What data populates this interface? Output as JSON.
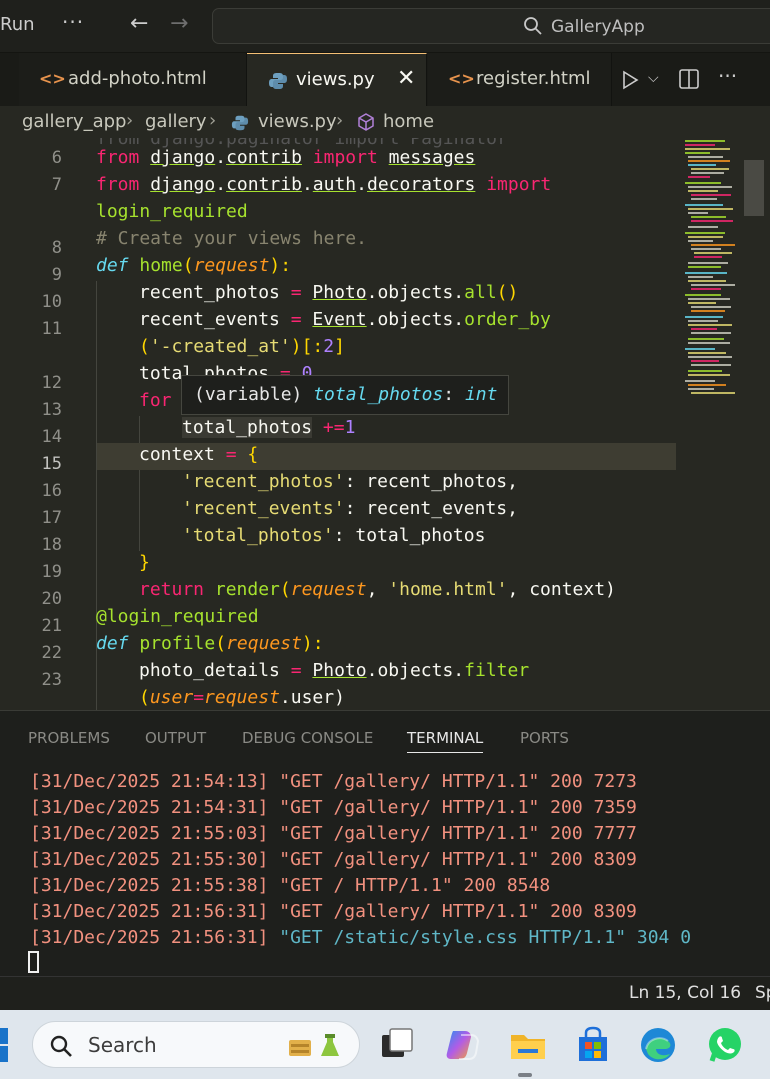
{
  "titlebar": {
    "run_label": "Run",
    "more_label": "···",
    "back_icon": "arrow-left-icon",
    "forward_icon": "arrow-right-icon",
    "search_text": "GalleryApp"
  },
  "tabs": [
    {
      "label": "add-photo.html",
      "icon": "html-icon"
    },
    {
      "label": "views.py",
      "icon": "python-icon",
      "close": "✕"
    },
    {
      "label": "register.html",
      "icon": "html-icon"
    }
  ],
  "breadcrumb": {
    "items": [
      "gallery_app",
      "gallery",
      "views.py",
      "home"
    ],
    "separator": "›"
  },
  "editor": {
    "line_numbers": [
      "6",
      "7",
      "",
      "8",
      "9",
      "10",
      "11",
      "",
      "12",
      "13",
      "14",
      "15",
      "16",
      "17",
      "18",
      "19",
      "20",
      "21",
      "22",
      "23",
      ""
    ],
    "current_line": "15",
    "hover": {
      "prefix": "(variable) ",
      "name": "total_photos",
      "colon": ": ",
      "type": "int"
    },
    "partial_top": "from django.paginator import Paginator",
    "code": {
      "l6": [
        "from",
        "django",
        ".",
        "contrib",
        "import",
        "messages"
      ],
      "l7": [
        "from",
        "django",
        ".",
        "contrib",
        ".",
        "auth",
        ".",
        "decorators",
        "import"
      ],
      "l7b": [
        "login_required"
      ],
      "l8": [
        "# Create your views here."
      ],
      "l9": [
        "def",
        "home",
        "(",
        "request",
        "):"
      ],
      "l10": [
        "recent_photos",
        "=",
        "Photo",
        ".objects.",
        "all",
        "()"
      ],
      "l11": [
        "recent_events",
        "=",
        "Event",
        ".objects.",
        "order_by"
      ],
      "l11b": [
        "(",
        "'-created_at'",
        ")[:",
        "2",
        "]"
      ],
      "l12": [
        "total_photos",
        "=",
        "0"
      ],
      "l13": [
        "for"
      ],
      "l14": [
        "total_photos",
        "+=",
        "1"
      ],
      "l15": [
        "context",
        "=",
        "{"
      ],
      "l16": [
        "'recent_photos'",
        ": recent_photos,"
      ],
      "l17": [
        "'recent_events'",
        ": recent_events,"
      ],
      "l18": [
        "'total_photos'",
        ": total_photos"
      ],
      "l19": [
        "}"
      ],
      "l20": [
        "return",
        "render",
        "(",
        "request",
        ", ",
        "'home.html'",
        ", context)"
      ],
      "l21": [
        "@login_required"
      ],
      "l22": [
        "def",
        "profile",
        "(",
        "request",
        "):"
      ],
      "l23": [
        "photo_details",
        "=",
        "Photo",
        ".objects.",
        "filter"
      ],
      "l23b": [
        "(",
        "user",
        "=",
        "request",
        ".user)"
      ]
    }
  },
  "panel": {
    "tabs": [
      "PROBLEMS",
      "OUTPUT",
      "DEBUG CONSOLE",
      "TERMINAL",
      "PORTS"
    ],
    "active_tab": "TERMINAL",
    "terminal_lines": [
      {
        "ts": "[31/Dec/2025 21:54:13]",
        "req": " \"GET /gallery/ HTTP/1.1\" 200 7273"
      },
      {
        "ts": "[31/Dec/2025 21:54:31]",
        "req": " \"GET /gallery/ HTTP/1.1\" 200 7359"
      },
      {
        "ts": "[31/Dec/2025 21:55:03]",
        "req": " \"GET /gallery/ HTTP/1.1\" 200 7777"
      },
      {
        "ts": "[31/Dec/2025 21:55:30]",
        "req": " \"GET /gallery/ HTTP/1.1\" 200 8309"
      },
      {
        "ts": "[31/Dec/2025 21:55:38]",
        "req": " \"GET / HTTP/1.1\" 200 8548"
      },
      {
        "ts": "[31/Dec/2025 21:56:31]",
        "req": " \"GET /gallery/ HTTP/1.1\" 200 8309"
      },
      {
        "ts": "[31/Dec/2025 21:56:31]",
        "req": " \"GET /static/style.css HTTP/1.1\" 304 0"
      }
    ]
  },
  "statusbar": {
    "position": "Ln 15, Col 16",
    "spaces": "Sp"
  },
  "taskbar": {
    "search_placeholder": "Search",
    "apps": [
      "task-view-icon",
      "copilot-icon",
      "file-explorer-icon",
      "microsoft-store-icon",
      "edge-icon",
      "whatsapp-icon"
    ]
  },
  "colors": {
    "editor_bg": "#272822",
    "keyword": "#f92672",
    "function": "#a6e22e",
    "string": "#e6db74",
    "parameter": "#fd971f",
    "terminal_text": "#f2917f",
    "terminal_ok": "#5fb7c7"
  }
}
